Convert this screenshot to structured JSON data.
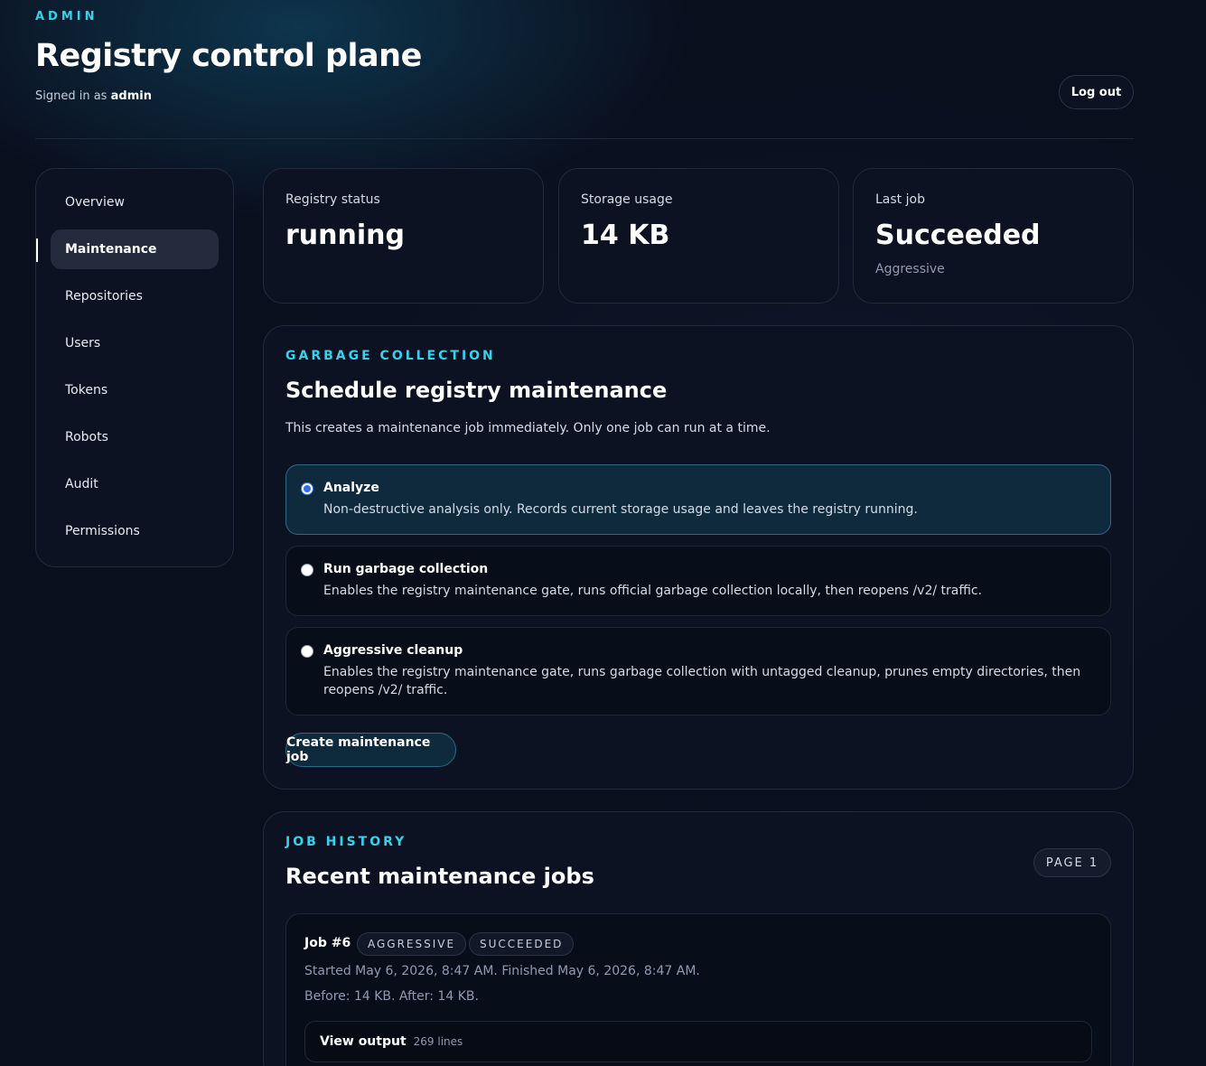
{
  "header": {
    "eyebrow": "ADMIN",
    "title": "Registry control plane",
    "signed_prefix": "Signed in as",
    "username": "admin",
    "logout_label": "Log out"
  },
  "sidebar": {
    "items": [
      {
        "label": "Overview"
      },
      {
        "label": "Maintenance",
        "active": true
      },
      {
        "label": "Repositories"
      },
      {
        "label": "Users"
      },
      {
        "label": "Tokens"
      },
      {
        "label": "Robots"
      },
      {
        "label": "Audit"
      },
      {
        "label": "Permissions"
      }
    ]
  },
  "stats": {
    "registry_status": {
      "label": "Registry status",
      "value": "running"
    },
    "storage_usage": {
      "label": "Storage usage",
      "value": "14 KB"
    },
    "last_job": {
      "label": "Last job",
      "value": "Succeeded",
      "sub": "Aggressive"
    }
  },
  "gc": {
    "eyebrow": "GARBAGE COLLECTION",
    "title": "Schedule registry maintenance",
    "description": "This creates a maintenance job immediately. Only one job can run at a time.",
    "options": [
      {
        "title": "Analyze",
        "description": "Non-destructive analysis only. Records current storage usage and leaves the registry running.",
        "selected": true
      },
      {
        "title": "Run garbage collection",
        "description": "Enables the registry maintenance gate, runs official garbage collection locally, then reopens /v2/ traffic.",
        "selected": false
      },
      {
        "title": "Aggressive cleanup",
        "description": "Enables the registry maintenance gate, runs garbage collection with untagged cleanup, prunes empty directories, then reopens /v2/ traffic.",
        "selected": false
      }
    ],
    "create_label": "Create maintenance job"
  },
  "history": {
    "eyebrow": "JOB HISTORY",
    "title": "Recent maintenance jobs",
    "page_label": "PAGE 1",
    "jobs": [
      {
        "id": "Job #6",
        "badges": [
          "AGGRESSIVE",
          "SUCCEEDED"
        ],
        "times": "Started May 6, 2026, 8:47 AM. Finished May 6, 2026, 8:47 AM.",
        "sizes": "Before: 14 KB. After: 14 KB.",
        "view_output_label": "View output",
        "output_lines": "269 lines"
      }
    ]
  },
  "colors": {
    "accent": "#33d3ec",
    "background": "#0a0f1e",
    "radio_selected": "#2f6ff0"
  }
}
